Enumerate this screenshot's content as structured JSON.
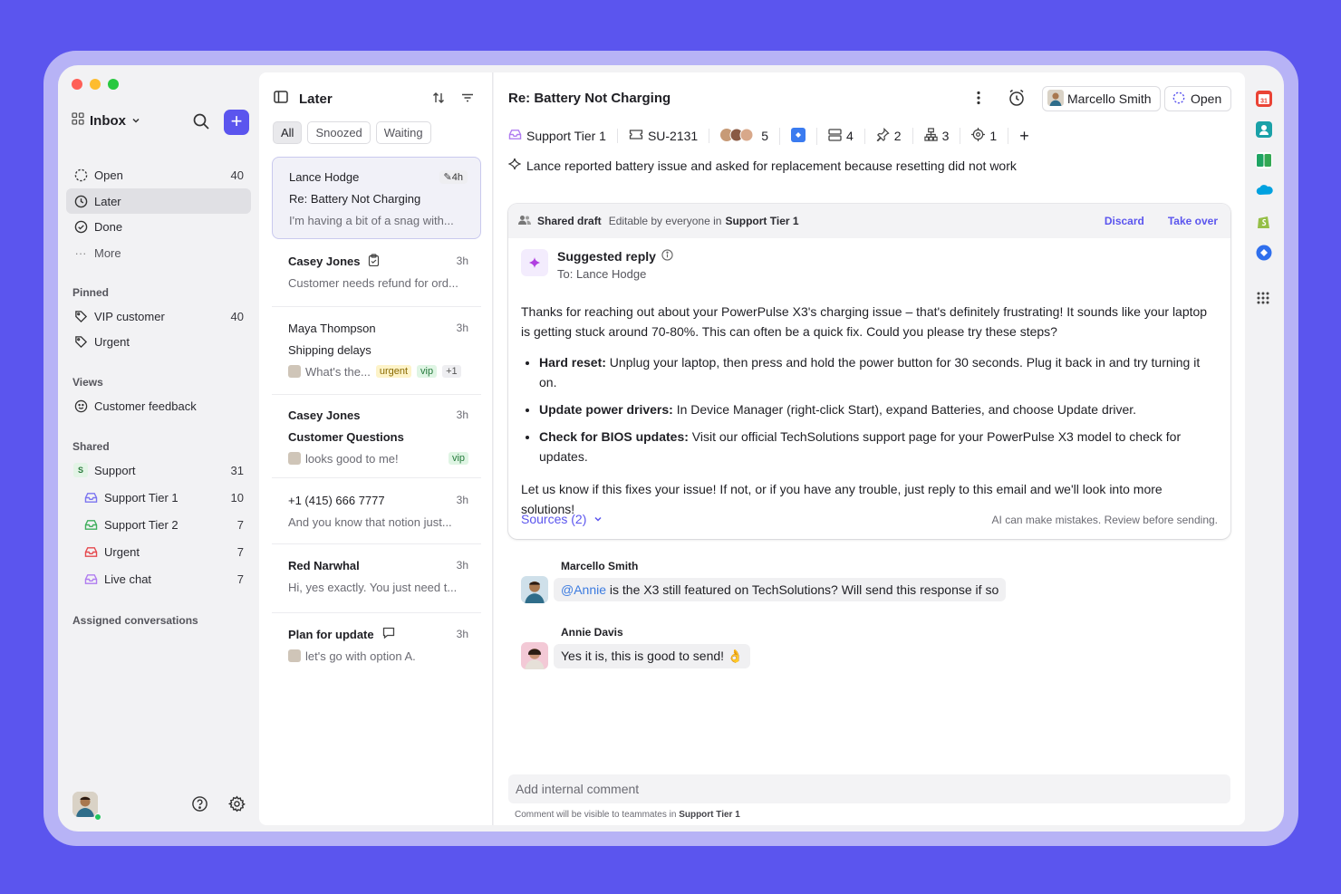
{
  "sidebar": {
    "inbox_label": "Inbox",
    "nav": [
      {
        "label": "Open",
        "count": "40"
      },
      {
        "label": "Later",
        "count": ""
      },
      {
        "label": "Done",
        "count": ""
      },
      {
        "label": "More",
        "count": ""
      }
    ],
    "pinned_title": "Pinned",
    "pinned": [
      {
        "label": "VIP customer",
        "count": "40"
      },
      {
        "label": "Urgent",
        "count": ""
      }
    ],
    "views_title": "Views",
    "views": [
      {
        "label": "Customer feedback"
      }
    ],
    "shared_title": "Shared",
    "shared": [
      {
        "label": "Support",
        "count": "31",
        "badge": "S"
      },
      {
        "label": "Support Tier 1",
        "count": "10"
      },
      {
        "label": "Support Tier 2",
        "count": "7"
      },
      {
        "label": "Urgent",
        "count": "7"
      },
      {
        "label": "Live chat",
        "count": "7"
      }
    ],
    "assigned_title": "Assigned conversations"
  },
  "list": {
    "title": "Later",
    "tabs": [
      "All",
      "Snoozed",
      "Waiting"
    ],
    "conversations": [
      {
        "name": "Lance Hodge",
        "time": "4h",
        "subject": "Re: Battery Not Charging",
        "preview": "I'm having a bit of a snag with..."
      },
      {
        "name": "Casey Jones",
        "time": "3h",
        "preview": "Customer needs refund for ord..."
      },
      {
        "name": "Maya Thompson",
        "time": "3h",
        "subject": "Shipping delays",
        "preview": "What's the...",
        "tags": [
          "urgent",
          "vip",
          "+1"
        ]
      },
      {
        "name": "Casey Jones",
        "time": "3h",
        "subject": "Customer Questions",
        "preview": "looks good to me!",
        "tags": [
          "vip"
        ]
      },
      {
        "name": "+1 (415) 666 7777",
        "time": "3h",
        "preview": "And you know that notion just..."
      },
      {
        "name": "Red Narwhal",
        "time": "3h",
        "preview": "Hi, yes exactly. You just need t..."
      },
      {
        "name": "Plan for update",
        "time": "3h",
        "preview": "let's go with option A."
      }
    ]
  },
  "main": {
    "title": "Re: Battery Not Charging",
    "assignee": "Marcello Smith",
    "status": "Open",
    "meta": {
      "team": "Support Tier 1",
      "ticket": "SU-2131",
      "participants": "5",
      "links": "4",
      "pins": "2",
      "tree": "3",
      "targets": "1"
    },
    "summary": "Lance reported battery issue and asked for replacement because resetting did not work",
    "draft": {
      "label": "Shared draft",
      "editable_prefix": "Editable by everyone in",
      "editable_team": "Support Tier 1",
      "discard": "Discard",
      "take_over": "Take over",
      "suggested_title": "Suggested reply",
      "to": "To: Lance Hodge",
      "intro": "Thanks for reaching out about your PowerPulse X3's charging issue – that's definitely frustrating! It sounds like your laptop is getting stuck around 70-80%. This can often be a quick fix. Could you please try these steps?",
      "steps": [
        {
          "bold": "Hard reset:",
          "text": " Unplug your laptop, then press and hold the power button for 30 seconds. Plug it back in and try turning it on."
        },
        {
          "bold": "Update power drivers:",
          "text": " In Device Manager (right-click Start), expand Batteries, and choose Update driver."
        },
        {
          "bold": "Check for BIOS updates:",
          "text": " Visit our official TechSolutions support page for your PowerPulse X3 model to check for updates."
        }
      ],
      "outro": "Let us know if this fixes your issue! If not, or if you have any trouble, just reply to this email and we'll look into more solutions!",
      "sources": "Sources (2)",
      "disclaimer": "AI can make mistakes. Review before sending."
    },
    "comments": [
      {
        "author": "Marcello Smith",
        "mention": "@Annie",
        "text": " is the X3 still featured on TechSolutions? Will send this response if so"
      },
      {
        "author": "Annie Davis",
        "text": "Yes it is, this is good to send! 👌"
      }
    ],
    "comment_placeholder": "Add internal comment",
    "comment_hint_prefix": "Comment will be visible to teammates in",
    "comment_hint_team": "Support Tier 1"
  },
  "colors": {
    "accent": "#5b55ee",
    "background": "#5b55ee"
  }
}
